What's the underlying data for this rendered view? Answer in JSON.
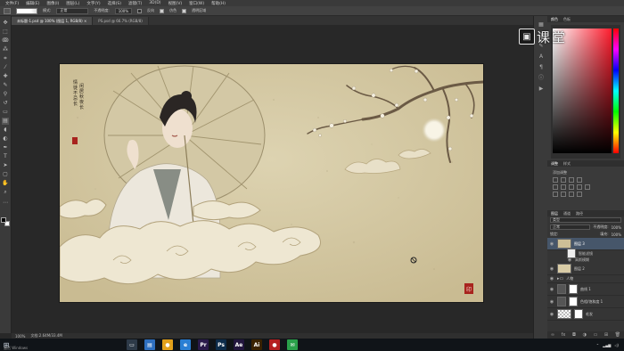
{
  "menubar": {
    "items": [
      "文件(F)",
      "编辑(E)",
      "图像(I)",
      "图层(L)",
      "文字(Y)",
      "选择(S)",
      "滤镜(T)",
      "3D(D)",
      "视图(V)",
      "窗口(W)",
      "帮助(H)"
    ]
  },
  "options": {
    "mode_label": "模式:",
    "mode_value": "正常",
    "opacity_label": "不透明度:",
    "opacity_value": "100%",
    "flow_label": "流量:",
    "flow_value": "100%",
    "reverse_label": "反向",
    "dither_label": "仿色",
    "transparency_label": "透明区域"
  },
  "tabs": [
    {
      "label": "未标题-1.psd @ 100% (图层 1, RGB/8) ×",
      "active": true
    },
    {
      "label": "PS.psd @ 66.7% (RGB/8)",
      "active": false
    }
  ],
  "status": {
    "zoom": "100%",
    "doc": "文档:2.64M/33.4M"
  },
  "brand": {
    "text": "课堂",
    "logo_char": "▣",
    "logo_color": "#e6e6e6"
  },
  "panels": {
    "top_tabs": [
      "颜色",
      "色板"
    ],
    "swatch_tabs": [
      "调整",
      "样式"
    ],
    "swatch_title": "添加调整",
    "layers_tabs": [
      "图层",
      "通道",
      "路径"
    ],
    "filter_label": "类型",
    "blend_mode": "正常",
    "opacity_label": "不透明度:",
    "opacity_value": "100%",
    "lock_label": "锁定:",
    "fill_label": "填充:",
    "fill_value": "100%"
  },
  "layers": [
    {
      "name": "图层 3",
      "selected": true,
      "thumb": "#cdbf97"
    },
    {
      "name": "智能滤镜",
      "selected": false,
      "thumb": "#eeeeee",
      "sub": true
    },
    {
      "name": "高斯模糊",
      "selected": false,
      "thumb": "",
      "sub": true
    },
    {
      "name": "图层 2",
      "selected": false,
      "thumb": "#d9cca6"
    },
    {
      "name": "人物",
      "selected": false,
      "thumb": "",
      "group": true
    },
    {
      "name": "曲线 1",
      "selected": false,
      "thumb": "#ffffff"
    },
    {
      "name": "色相/饱和度 1",
      "selected": false,
      "thumb": "#ffffff"
    },
    {
      "name": "毛发",
      "selected": false,
      "thumb": "#ffffff"
    }
  ],
  "artwork": {
    "poem_col1": "情徒不忌长",
    "poem_col2": "闲居秋夜长",
    "seal": "印"
  },
  "taskbar": {
    "start_icon": "windows-icon",
    "watermark": "激活 Windows",
    "apps": [
      {
        "name": "task-view-icon",
        "label": "▭",
        "color": "#2d3a48"
      },
      {
        "name": "store-icon",
        "label": "▤",
        "color": "#2e6fbf"
      },
      {
        "name": "chrome-icon",
        "label": "●",
        "color": "#e3a11b"
      },
      {
        "name": "edge-icon",
        "label": "e",
        "color": "#2a7fd4"
      },
      {
        "name": "premiere-icon",
        "label": "Pr",
        "color": "#2a1a4a"
      },
      {
        "name": "photoshop-icon",
        "label": "Ps",
        "color": "#0d2c4a"
      },
      {
        "name": "aftereffects-icon",
        "label": "Ae",
        "color": "#22163d"
      },
      {
        "name": "illustrator-icon",
        "label": "Ai",
        "color": "#3a2200"
      },
      {
        "name": "record-icon",
        "label": "●",
        "color": "#b52020"
      },
      {
        "name": "wechat-icon",
        "label": "✉",
        "color": "#2aa04a"
      }
    ]
  },
  "colors": {
    "accent": "#46566a",
    "canvas_bg": "#d7cca9",
    "app_bg": "#282828"
  }
}
